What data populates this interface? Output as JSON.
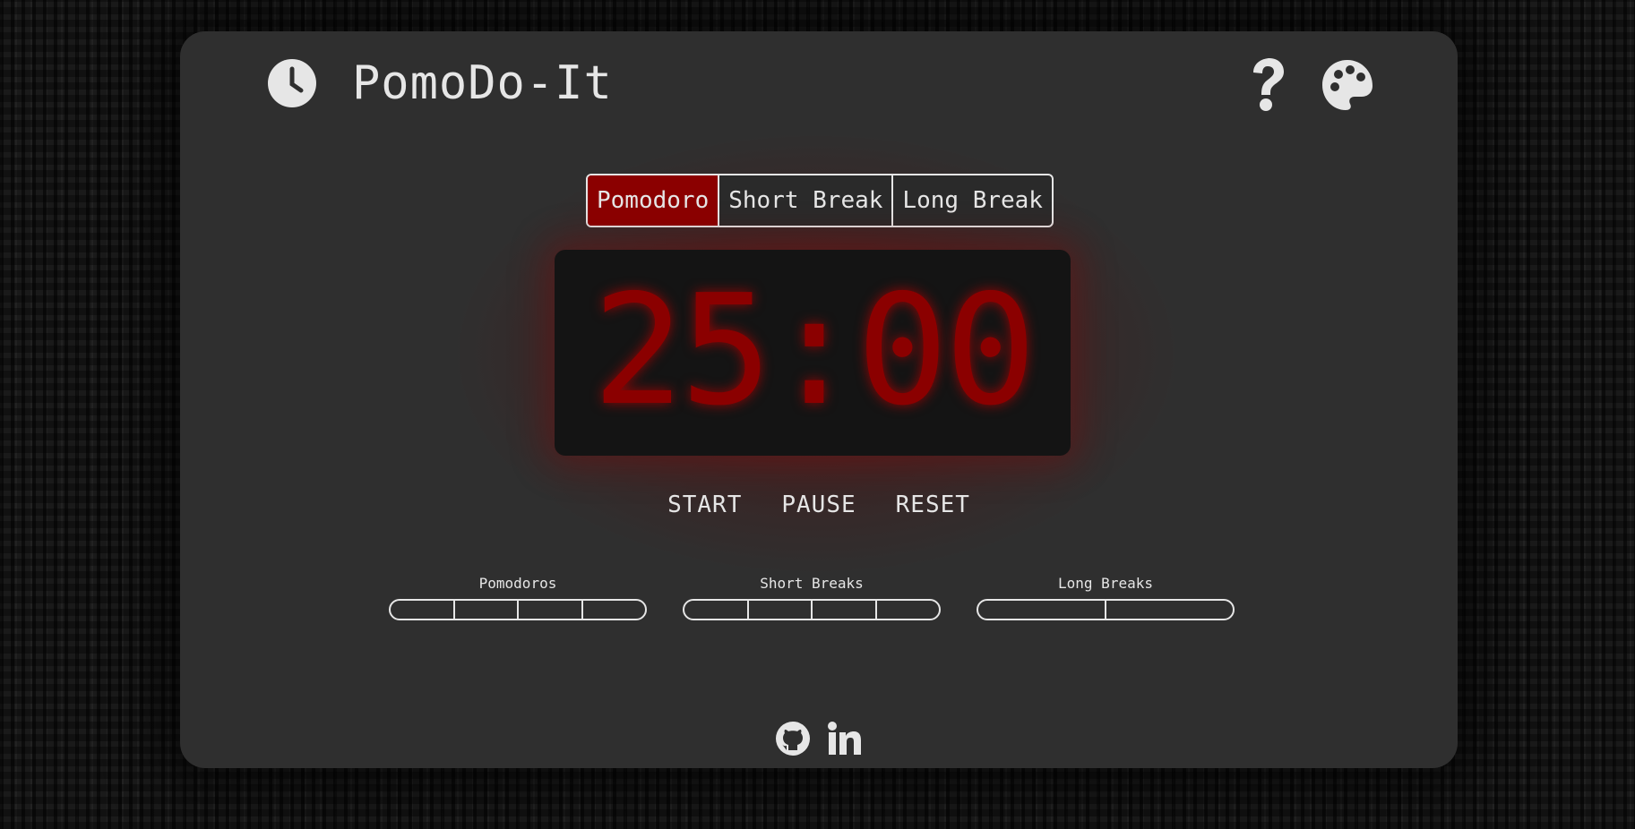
{
  "header": {
    "title": "PomoDo-It",
    "logo_icon": "clock-icon",
    "help_icon": "question-icon",
    "theme_icon": "palette-icon"
  },
  "tabs": [
    {
      "label": "Pomodoro",
      "active": true
    },
    {
      "label": "Short Break",
      "active": false
    },
    {
      "label": "Long Break",
      "active": false
    }
  ],
  "timer": {
    "display": "25:00"
  },
  "controls": {
    "start_label": "START",
    "pause_label": "PAUSE",
    "reset_label": "RESET"
  },
  "trackers": [
    {
      "label": "Pomodoros",
      "segments": 4,
      "completed": 0
    },
    {
      "label": "Short Breaks",
      "segments": 4,
      "completed": 0
    },
    {
      "label": "Long Breaks",
      "segments": 2,
      "completed": 0
    }
  ],
  "footer": {
    "links": [
      {
        "icon": "github-icon"
      },
      {
        "icon": "linkedin-icon"
      }
    ]
  },
  "colors": {
    "accent": "#8b0000",
    "card_bg": "#2f2f2f",
    "display_bg": "#141414",
    "text": "#e6e6e6"
  }
}
